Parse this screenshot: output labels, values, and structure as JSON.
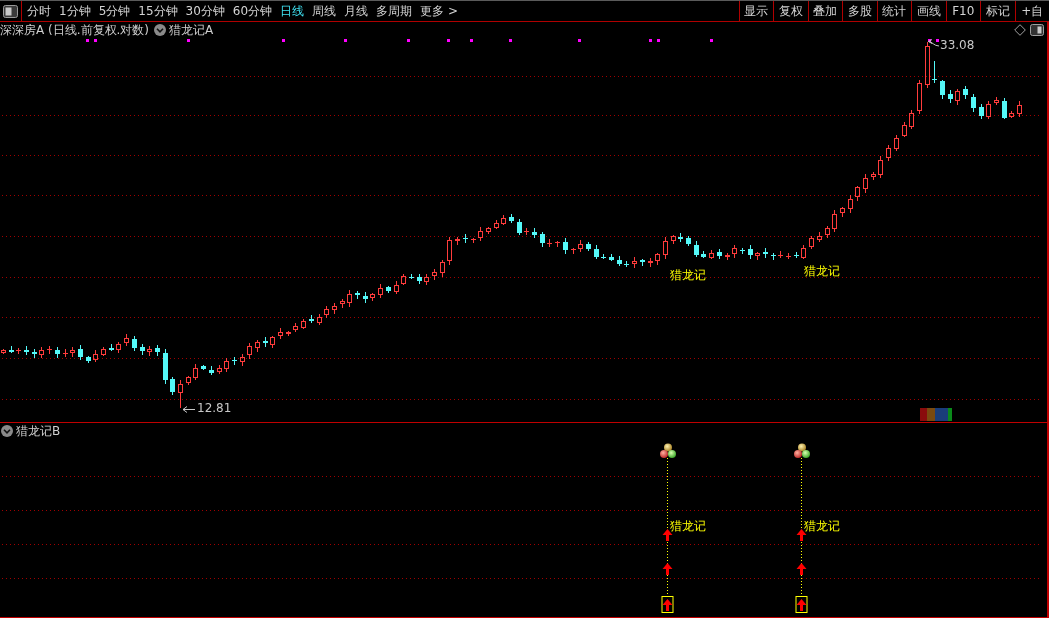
{
  "toolbar": {
    "periods": [
      {
        "label": "分时",
        "selected": false
      },
      {
        "label": "1分钟",
        "selected": false
      },
      {
        "label": "5分钟",
        "selected": false
      },
      {
        "label": "15分钟",
        "selected": false
      },
      {
        "label": "30分钟",
        "selected": false
      },
      {
        "label": "60分钟",
        "selected": false
      },
      {
        "label": "日线",
        "selected": true
      },
      {
        "label": "周线",
        "selected": false
      },
      {
        "label": "月线",
        "selected": false
      },
      {
        "label": "多周期",
        "selected": false
      }
    ],
    "more": "更多 >",
    "actions": [
      "显示",
      "复权",
      "叠加",
      "多股",
      "统计",
      "画线",
      "F10",
      "标记",
      "+自"
    ]
  },
  "main_panel": {
    "title": "深深房A (日线.前复权.对数)",
    "indicator": "猎龙记A",
    "high_label": "33.08",
    "low_label": "12.81",
    "signal_labels": [
      "猎龙记",
      "猎龙记"
    ]
  },
  "sub_panel": {
    "indicator": "猎龙记B",
    "signals": [
      {
        "label": "猎龙记"
      },
      {
        "label": "猎龙记"
      }
    ]
  }
}
